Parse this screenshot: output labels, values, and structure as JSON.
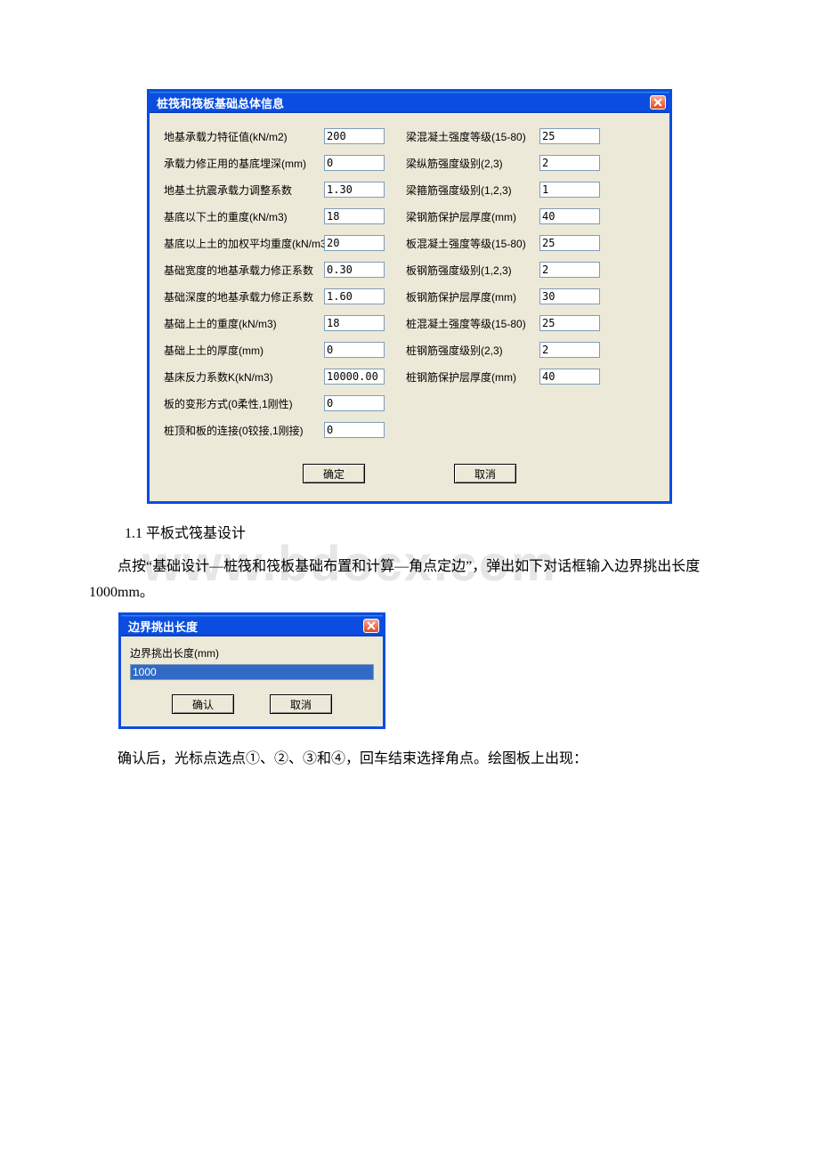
{
  "dialog1": {
    "title": "桩筏和筏板基础总体信息",
    "left": [
      {
        "label": "地基承载力特征值(kN/m2)",
        "value": "200"
      },
      {
        "label": "承载力修正用的基底埋深(mm)",
        "value": "0"
      },
      {
        "label": "地基土抗震承载力调整系数",
        "value": "1.30"
      },
      {
        "label": "基底以下土的重度(kN/m3)",
        "value": "18"
      },
      {
        "label": "基底以上土的加权平均重度(kN/m3)",
        "value": "20"
      },
      {
        "label": "基础宽度的地基承载力修正系数",
        "value": "0.30"
      },
      {
        "label": "基础深度的地基承载力修正系数",
        "value": "1.60"
      },
      {
        "label": "基础上土的重度(kN/m3)",
        "value": "18"
      },
      {
        "label": "基础上土的厚度(mm)",
        "value": "0"
      },
      {
        "label": "基床反力系数K(kN/m3)",
        "value": "10000.00"
      },
      {
        "label": "板的变形方式(0柔性,1刚性)",
        "value": "0"
      },
      {
        "label": "桩顶和板的连接(0铰接,1刚接)",
        "value": "0"
      }
    ],
    "right": [
      {
        "label": "梁混凝土强度等级(15-80)",
        "value": "25"
      },
      {
        "label": "梁纵筋强度级别(2,3)",
        "value": "2"
      },
      {
        "label": "梁箍筋强度级别(1,2,3)",
        "value": "1"
      },
      {
        "label": "梁钢筋保护层厚度(mm)",
        "value": "40"
      },
      {
        "label": "板混凝土强度等级(15-80)",
        "value": "25"
      },
      {
        "label": "板钢筋强度级别(1,2,3)",
        "value": "2"
      },
      {
        "label": "板钢筋保护层厚度(mm)",
        "value": "30"
      },
      {
        "label": "桩混凝土强度等级(15-80)",
        "value": "25"
      },
      {
        "label": "桩钢筋强度级别(2,3)",
        "value": "2"
      },
      {
        "label": "桩钢筋保护层厚度(mm)",
        "value": "40"
      }
    ],
    "ok": "确定",
    "cancel": "取消"
  },
  "text1": "1.1 平板式筏基设计",
  "text2": "点按“基础设计—桩筏和筏板基础布置和计算—角点定边”，弹出如下对话框输入边界挑出长度 1000mm。",
  "dialog2": {
    "title": "边界挑出长度",
    "label": "边界挑出长度(mm)",
    "value": "1000",
    "ok": "确认",
    "cancel": "取消"
  },
  "text3": "确认后，光标点选点①、②、③和④，回车结束选择角点。绘图板上出现：",
  "watermark": "www.bdocx.com"
}
